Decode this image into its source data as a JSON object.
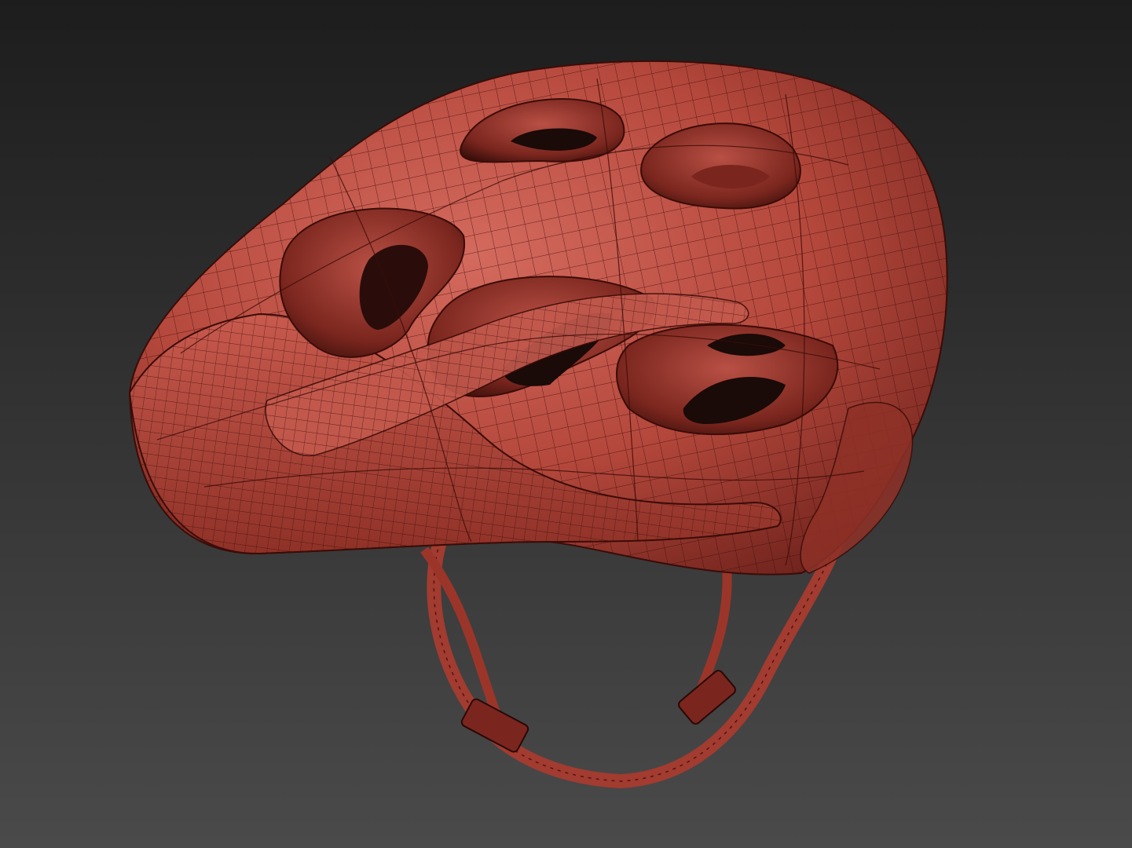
{
  "scene": {
    "subject": "helmet-wireframe-render",
    "colors": {
      "background_top": "#1d1d1d",
      "background_bottom": "#4a4a4a",
      "shell_light": "#d46a5e",
      "shell_mid": "#b5483c",
      "shell_dark": "#6e221c",
      "vent_deep": "#1a0a08",
      "wire": "#3a0c08",
      "strap": "#a23b30"
    }
  }
}
